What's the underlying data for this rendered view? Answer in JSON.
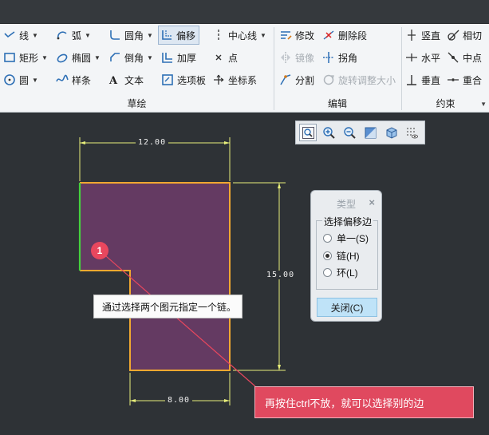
{
  "ribbon": {
    "sketch": {
      "label": "草绘",
      "tools": {
        "line": "线",
        "arc": "弧",
        "fillet": "圆角",
        "offset": "偏移",
        "centerline": "中心线",
        "rectangle": "矩形",
        "ellipse": "椭圆",
        "chamfer": "倒角",
        "thicken": "加厚",
        "point": "点",
        "circle": "圆",
        "spline": "样条",
        "text": "文本",
        "palette": "选项板",
        "coordsys": "坐标系"
      }
    },
    "edit": {
      "label": "编辑",
      "tools": {
        "modify": "修改",
        "delete_segment": "删除段",
        "mirror": "镜像",
        "corner": "拐角",
        "divide": "分割",
        "rotate_resize": "旋转调整大小"
      }
    },
    "constrain": {
      "label": "约束",
      "tools": {
        "vertical": "竖直",
        "tangent": "相切",
        "horizontal": "水平",
        "midpoint": "中点",
        "perpendicular": "垂直",
        "coincident": "重合"
      }
    }
  },
  "canvas": {
    "dimensions": {
      "width_top": "12.00",
      "height_right": "15.00",
      "width_bottom": "8.00"
    },
    "tooltip": "通过选择两个图元指定一个链。",
    "marker": "1",
    "callout": "再按住ctrl不放，就可以选择别的边",
    "colors": {
      "shape_fill": "#643a62",
      "edge": "#f0a830",
      "selected_edge": "#44d13d",
      "dimension": "#e8ef7a",
      "callout": "#e0495f"
    }
  },
  "dialog": {
    "title": "类型",
    "close_icon": "×",
    "group_label": "选择偏移边",
    "options": [
      {
        "label": "单一(S)",
        "selected": false
      },
      {
        "label": "链(H)",
        "selected": true
      },
      {
        "label": "环(L)",
        "selected": false
      }
    ],
    "close_button": "关闭(C)"
  }
}
